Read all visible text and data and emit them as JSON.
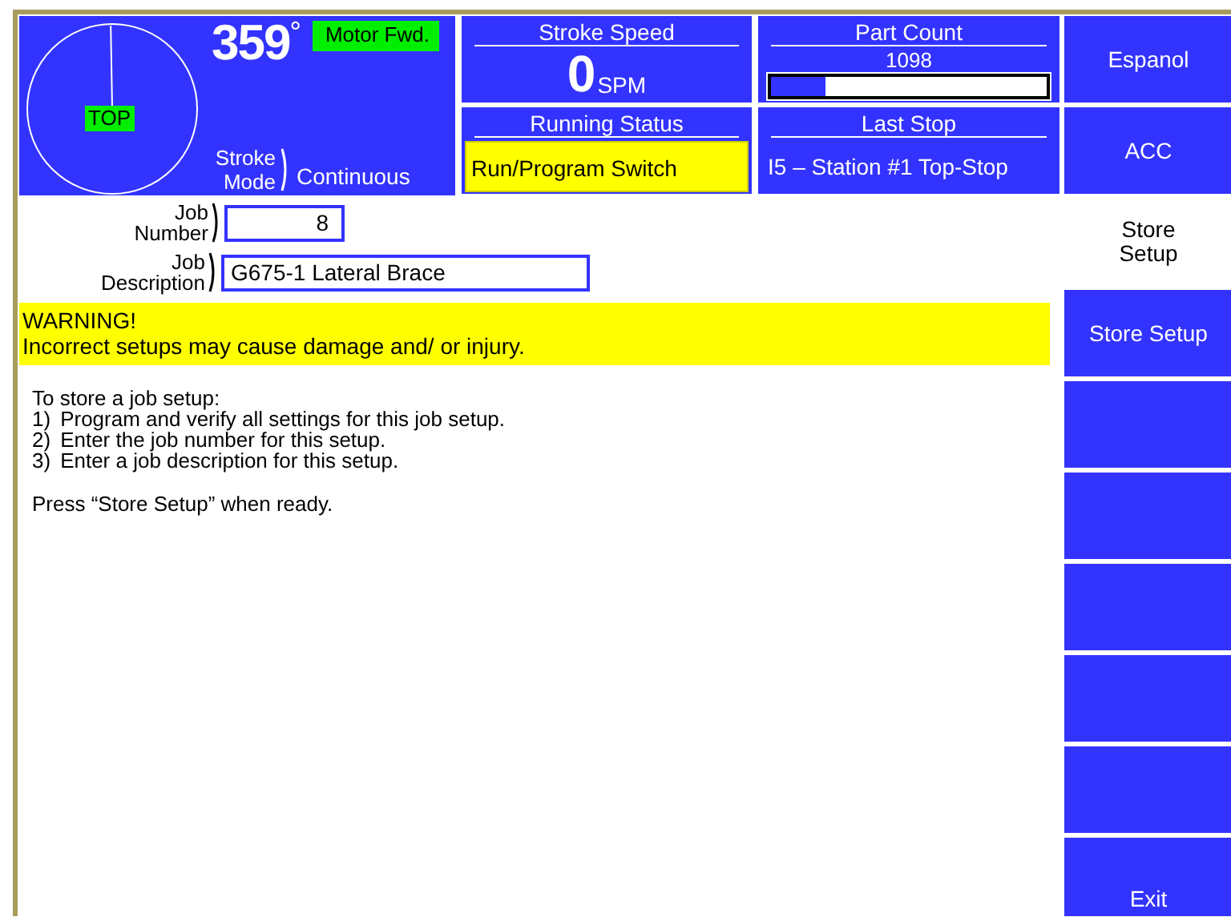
{
  "dial": {
    "position_label": "TOP",
    "angle": "359",
    "degree_sign": "°",
    "motor_status": "Motor Fwd.",
    "stroke_mode_label": "Stroke Mode",
    "stroke_mode": "Continuous"
  },
  "status_panels": [
    {
      "kind": "speed",
      "title": "Stroke Speed",
      "value": "0",
      "unit": "SPM"
    },
    {
      "kind": "count",
      "title": "Part Count",
      "value": "1098",
      "level": 0.2
    },
    {
      "kind": "alert",
      "title": "Running Status",
      "value": "Run/Program Switch"
    },
    {
      "kind": "plain",
      "title": "Last Stop",
      "value": "I5 – Station #1 Top-Stop"
    }
  ],
  "fields": [
    {
      "label": "Job Number",
      "value": "8",
      "kind": "number"
    },
    {
      "label": "Job Description",
      "value": "G675-1 Lateral Brace",
      "kind": "text"
    }
  ],
  "warning": {
    "title": "WARNING!",
    "text": "Incorrect setups may cause damage and/ or injury."
  },
  "instructions": {
    "intro": "To store a job setup:",
    "steps": [
      {
        "number": "1)",
        "text": "Program and verify all settings for this job setup."
      },
      {
        "number": "2)",
        "text": "Enter the job number for this setup."
      },
      {
        "number": "3)",
        "text": "Enter a job description for this setup."
      }
    ],
    "closing": "Press “Store Setup” when ready."
  },
  "sidebar": [
    {
      "kind": "button",
      "label": "Espanol"
    },
    {
      "kind": "button",
      "label": "ACC"
    },
    {
      "kind": "title",
      "label": "Store Setup"
    },
    {
      "kind": "button",
      "label": "Store Setup"
    },
    {
      "kind": "blank"
    },
    {
      "kind": "blank"
    },
    {
      "kind": "blank"
    },
    {
      "kind": "blank"
    },
    {
      "kind": "blank"
    },
    {
      "kind": "button",
      "label": "Exit"
    }
  ]
}
